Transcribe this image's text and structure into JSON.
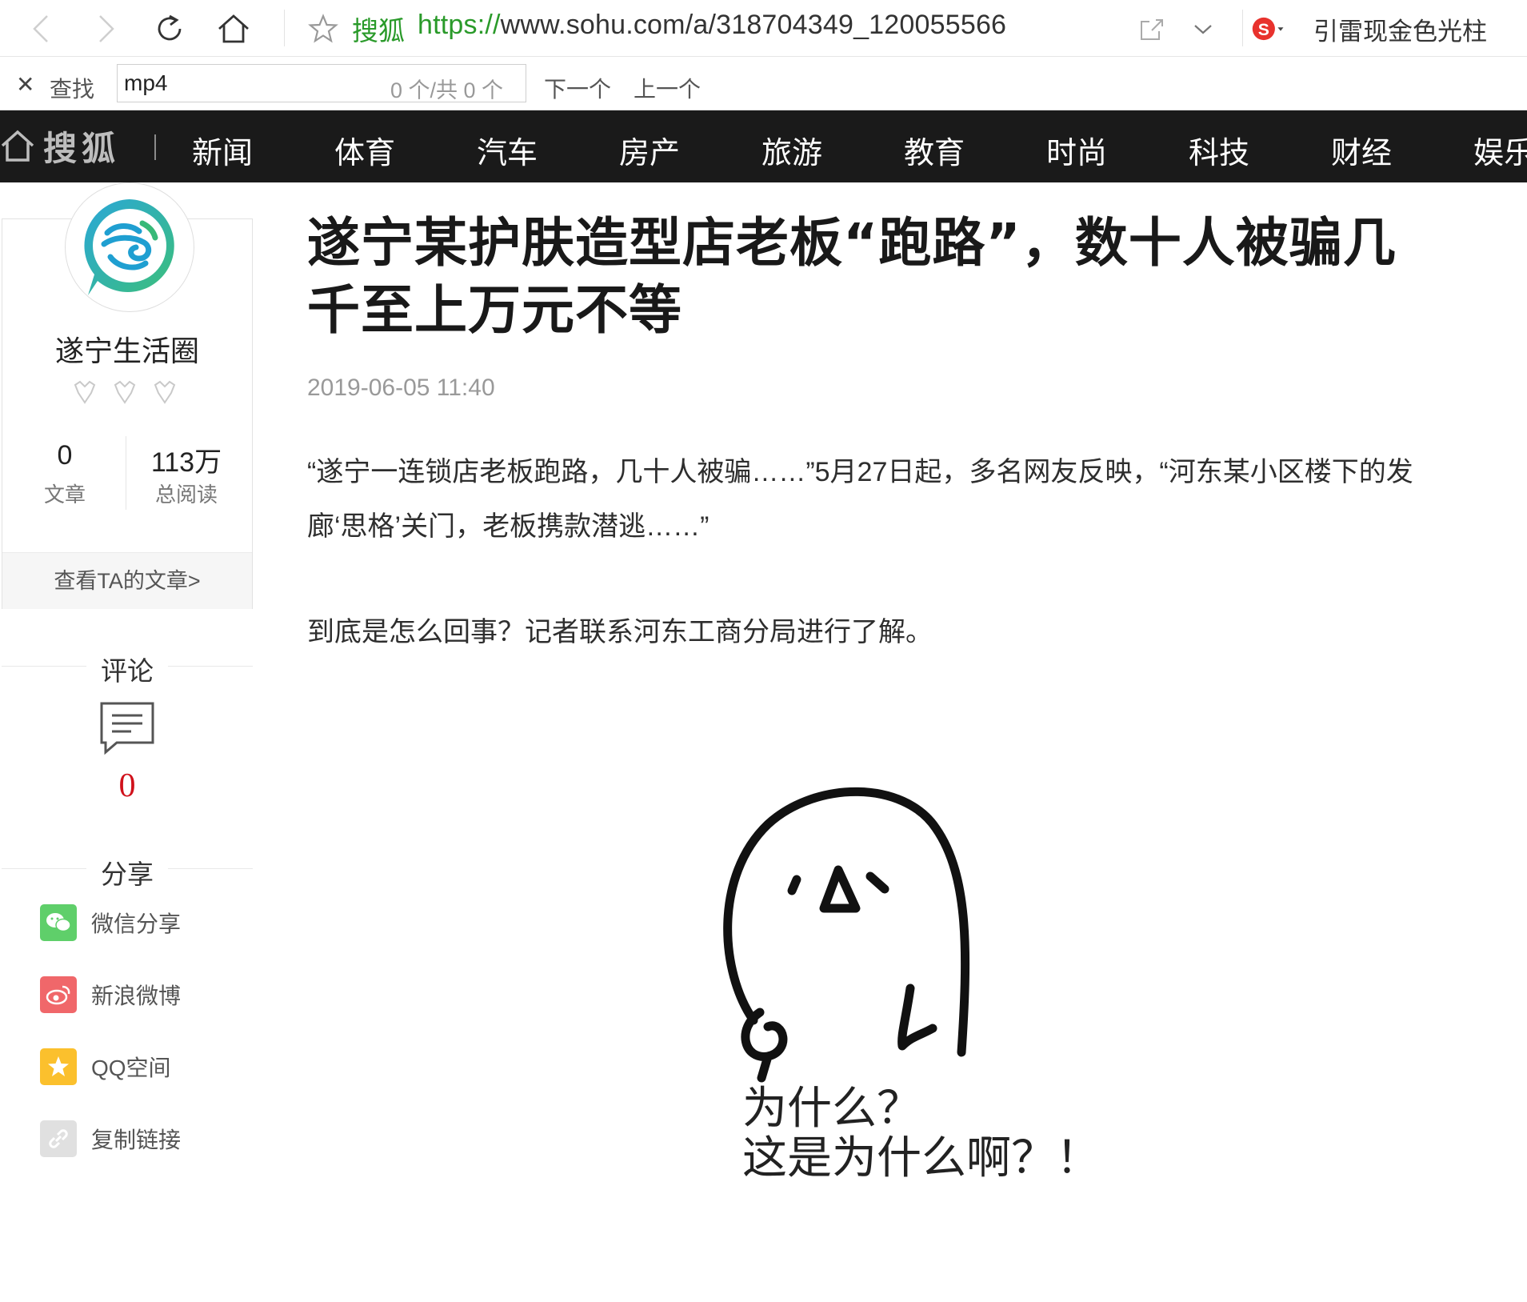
{
  "browser": {
    "site_tag": "搜狐",
    "url_protocol": "https://",
    "url_rest": "www.sohu.com/a/318704349_120055566",
    "extension_text": "引雷现金色光柱"
  },
  "findbar": {
    "label": "查找",
    "query": "mp4",
    "count": "0 个/共 0 个",
    "next": "下一个",
    "prev": "上一个"
  },
  "sohu_nav": {
    "logo_text": "搜狐",
    "items": [
      "新闻",
      "体育",
      "汽车",
      "房产",
      "旅游",
      "教育",
      "时尚",
      "科技",
      "财经",
      "娱乐"
    ]
  },
  "author": {
    "name": "遂宁生活圈",
    "articles_num": "0",
    "articles_label": "文章",
    "reads_num": "113万",
    "reads_label": "总阅读",
    "view_link": "查看TA的文章>"
  },
  "comments": {
    "heading": "评论",
    "count": "0"
  },
  "share": {
    "heading": "分享",
    "items": [
      "微信分享",
      "新浪微博",
      "QQ空间",
      "复制链接"
    ]
  },
  "article": {
    "title": "遂宁某护肤造型店老板“跑路”，数十人被骗几千至上万元不等",
    "time": "2019-06-05 11:40",
    "para1": "“遂宁一连锁店老板跑路，几十人被骗……”5月27日起，多名网友反映，“河东某小区楼下的发廊‘思格’关门，老板携款潜逃……”",
    "para2": "到底是怎么回事？记者联系河东工商分局进行了解。",
    "meme_line1": "为什么？",
    "meme_line2": "这是为什么啊？！"
  },
  "colors": {
    "nav_bg": "#1a1a1a",
    "accent_green": "#2a9a2a",
    "comment_red": "#d0111b",
    "wechat": "#5fcf6a",
    "weibo": "#f0676a",
    "qzone": "#fbc02d",
    "link": "#e0e0e0"
  }
}
